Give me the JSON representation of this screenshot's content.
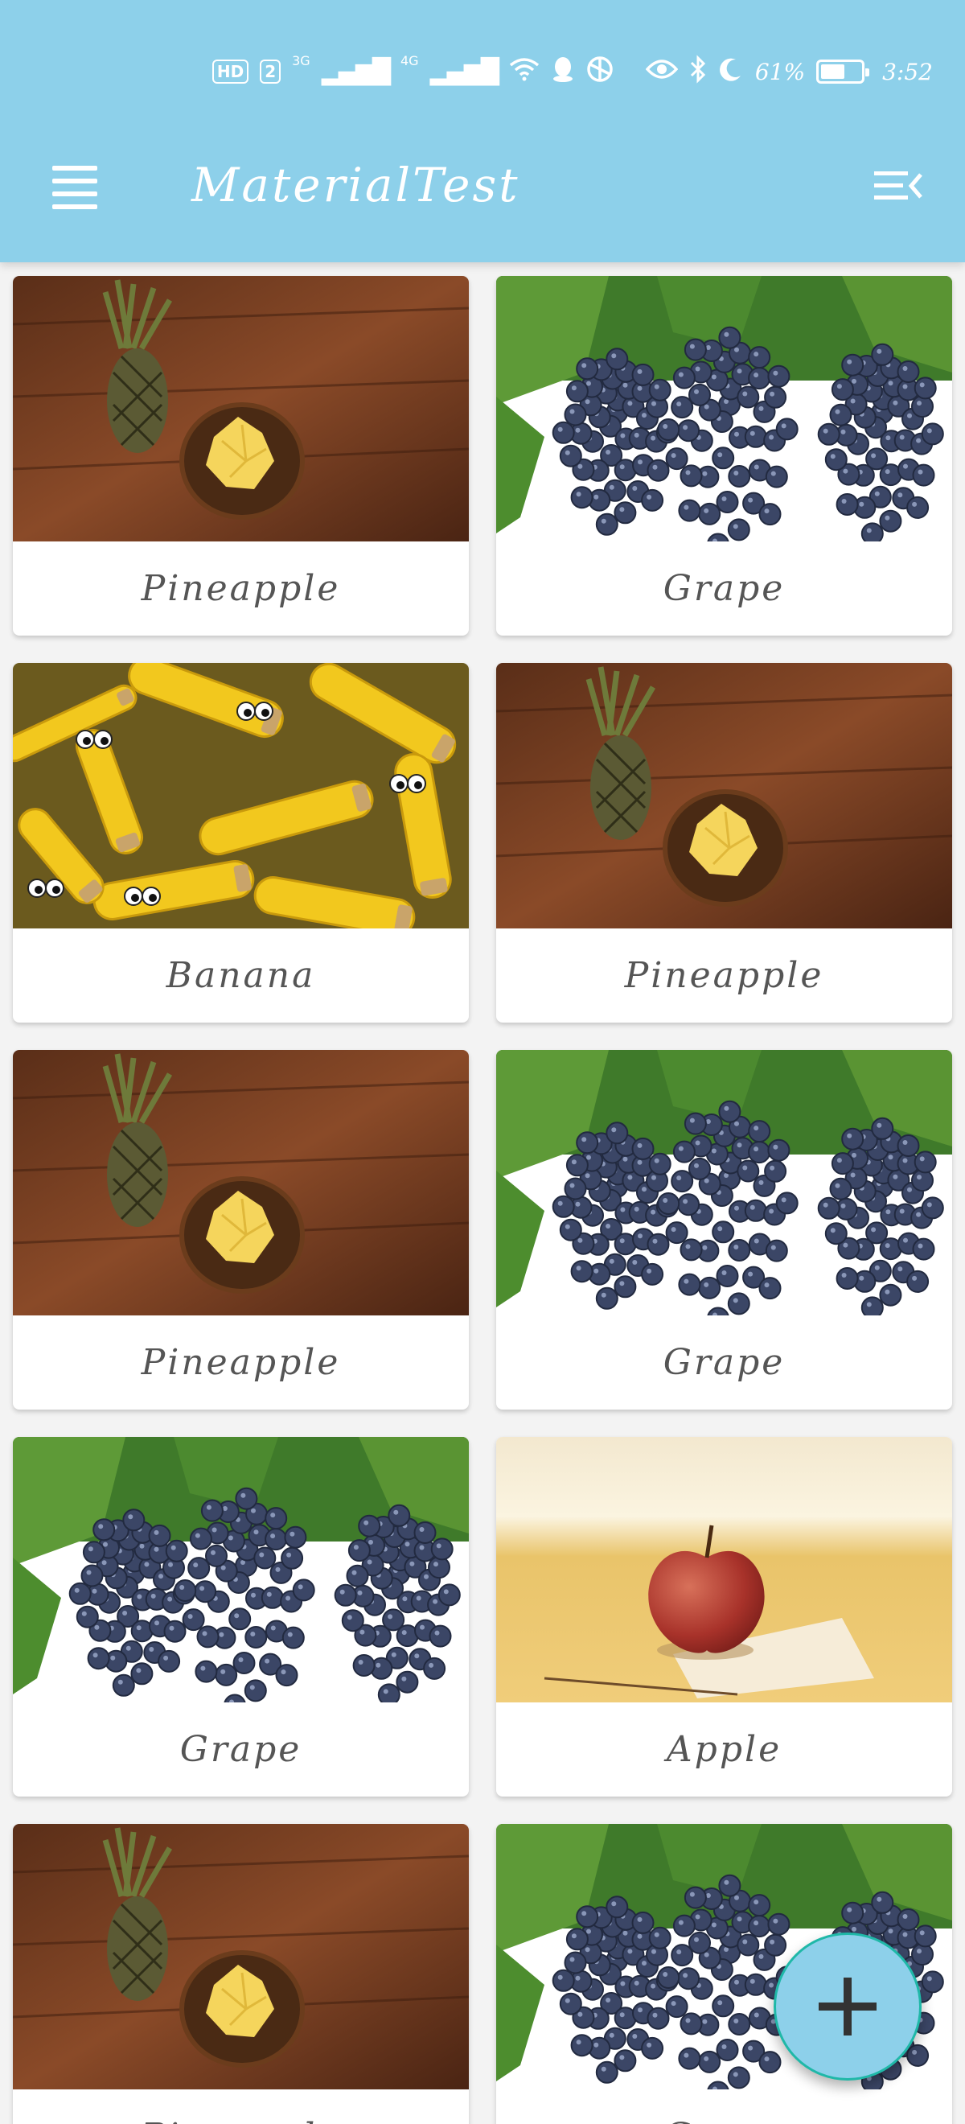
{
  "status_bar": {
    "hd_badge": "HD",
    "sim_badge": "2",
    "net1": "3G",
    "net2": "4G",
    "battery_text": "61%",
    "battery_level": 0.61,
    "time": "3:52",
    "icons": [
      "signal-icon",
      "wifi-icon",
      "qq-icon",
      "app-icon",
      "eye-icon",
      "bluetooth-icon",
      "moon-icon"
    ]
  },
  "toolbar": {
    "title": "MaterialTest",
    "menu_icon": "menu-icon",
    "action_icon": "menu-collapse-icon",
    "color": "#8dd0ea"
  },
  "fruits": [
    {
      "name": "Pineapple",
      "image": "pineapple"
    },
    {
      "name": "Grape",
      "image": "grape"
    },
    {
      "name": "Banana",
      "image": "banana"
    },
    {
      "name": "Pineapple",
      "image": "pineapple"
    },
    {
      "name": "Pineapple",
      "image": "pineapple"
    },
    {
      "name": "Grape",
      "image": "grape"
    },
    {
      "name": "Grape",
      "image": "grape"
    },
    {
      "name": "Apple",
      "image": "apple"
    },
    {
      "name": "Pineapple",
      "image": "pineapple"
    },
    {
      "name": "Grape",
      "image": "grape"
    }
  ],
  "fab": {
    "icon": "plus-icon",
    "color": "#8dd0ea"
  }
}
